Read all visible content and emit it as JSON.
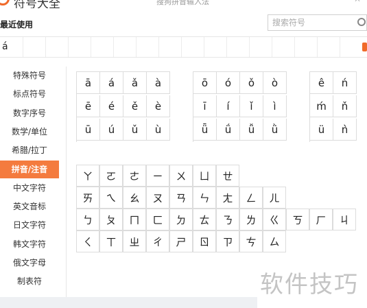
{
  "app_title": "符号大全",
  "window_hint": "搜狗拼音输入法",
  "recent": {
    "title": "最近使用",
    "symbols": [
      "á",
      "",
      "",
      "",
      "",
      "",
      "",
      "",
      "",
      "",
      "",
      "",
      "",
      "",
      "",
      ""
    ]
  },
  "search": {
    "placeholder": "搜索符号"
  },
  "sidebar": {
    "items": [
      "特殊符号",
      "标点符号",
      "数字序号",
      "数学/单位",
      "希腊/拉丁",
      "拼音/注音",
      "中文字符",
      "英文音标",
      "日文字符",
      "韩文字符",
      "俄文字母",
      "制表符"
    ],
    "active_index": 5
  },
  "pinyin_groups": [
    {
      "rows": [
        [
          "ā",
          "á",
          "ǎ",
          "à"
        ],
        [
          "ē",
          "é",
          "ě",
          "è"
        ],
        [
          "ū",
          "ú",
          "ǔ",
          "ù"
        ]
      ]
    },
    {
      "rows": [
        [
          "ō",
          "ó",
          "ǒ",
          "ò"
        ],
        [
          "ī",
          "í",
          "ǐ",
          "ì"
        ],
        [
          "ǖ",
          "ǘ",
          "ǚ",
          "ǜ"
        ]
      ]
    },
    {
      "rows": [
        [
          "ê",
          "ń"
        ],
        [
          "ḿ",
          "ň"
        ],
        [
          "ü",
          "ǹ"
        ]
      ]
    }
  ],
  "zhuyin_rows": [
    [
      "ㄚ",
      "ㄛ",
      "ㄜ",
      "ㄧ",
      "ㄨ",
      "ㄩ",
      "ㄝ"
    ],
    [
      "ㄞ",
      "ㄟ",
      "ㄠ",
      "ㄡ",
      "ㄢ",
      "ㄣ",
      "ㄤ",
      "ㄥ",
      "ㄦ"
    ],
    [
      "ㄅ",
      "ㄆ",
      "ㄇ",
      "ㄈ",
      "ㄉ",
      "ㄊ",
      "ㄋ",
      "ㄌ",
      "ㄍ",
      "ㄎ",
      "ㄏ",
      "ㄐ"
    ],
    [
      "ㄑ",
      "ㄒ",
      "ㄓ",
      "ㄔ",
      "ㄕ",
      "ㄖ",
      "ㄗ",
      "ㄘ",
      "ㄙ"
    ]
  ],
  "watermark": "软件技巧",
  "colors": {
    "accent": "#f47b3e",
    "grid_line": "#dcdcdc",
    "watermark": "#c4c4c4"
  }
}
